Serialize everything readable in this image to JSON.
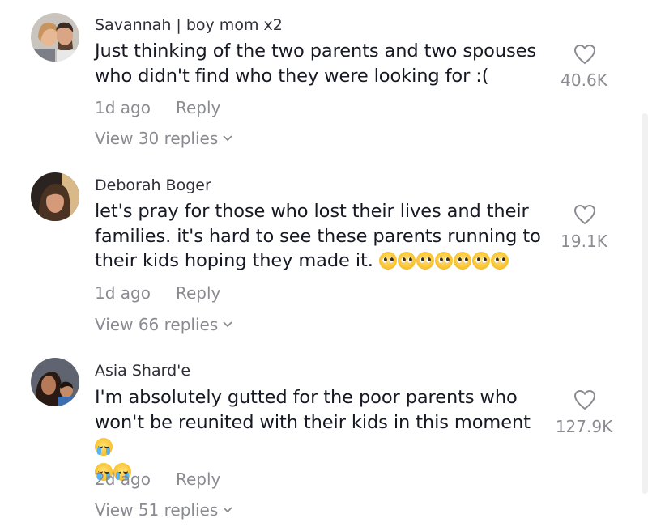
{
  "comments": [
    {
      "username": "Savannah | boy mom x2",
      "text_lines": [
        "Just thinking of the two parents and two spouses",
        "who didn't find who they were looking for :("
      ],
      "time": "1d ago",
      "reply_label": "Reply",
      "view_replies": "View 30 replies",
      "likes": "40.6K"
    },
    {
      "username": "Deborah Boger",
      "text_lines": [
        "let's pray for those who lost their lives and their",
        "families. it's hard to see these parents running to",
        "their kids hoping they made it."
      ],
      "emojis": [
        "pleading-face-emoji",
        "pleading-face-emoji",
        "pleading-face-emoji",
        "pleading-face-emoji",
        "pleading-face-emoji",
        "pleading-face-emoji",
        "pleading-face-emoji"
      ],
      "time": "1d ago",
      "reply_label": "Reply",
      "view_replies": "View 66 replies",
      "likes": "19.1K"
    },
    {
      "username": "Asia Shard'e",
      "text_lines": [
        "I'm absolutely gutted for the poor parents who",
        "won't be reunited with their kids in this moment"
      ],
      "emojis": [
        "loudly-crying-face-emoji",
        "loudly-crying-face-emoji",
        "loudly-crying-face-emoji"
      ],
      "time": "2d ago",
      "reply_label": "Reply",
      "view_replies": "View 51 replies",
      "likes": "127.9K"
    }
  ],
  "icons": {
    "like": "heart-outline-icon",
    "expand": "chevron-down-icon"
  },
  "colors": {
    "text": "#161823",
    "secondary": "#8a8b91",
    "username": "#2f2f38"
  }
}
